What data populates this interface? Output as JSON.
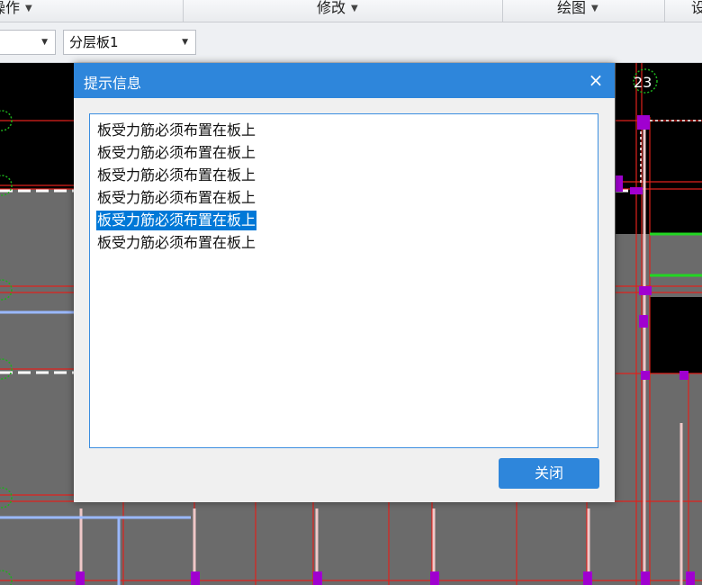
{
  "toolbar": {
    "groups": [
      {
        "label": "操作",
        "label_visible": "操作"
      },
      {
        "label": "修改"
      },
      {
        "label": "绘图"
      },
      {
        "label": "设"
      }
    ],
    "selectors": [
      {
        "value": ""
      },
      {
        "value": "分层板1"
      }
    ]
  },
  "canvas": {
    "axis_labels": [
      "23"
    ],
    "colors": {
      "background": "#6b6b6b",
      "grid_line": "#e0221c",
      "column": "#a000d0",
      "beam_green": "#22d722",
      "beam_blue": "#9ab8ff",
      "axis_circle": "#1cb01c"
    }
  },
  "dialog": {
    "title": "提示信息",
    "close_icon": "×",
    "messages": [
      "板受力筋必须布置在板上",
      "板受力筋必须布置在板上",
      "板受力筋必须布置在板上",
      "板受力筋必须布置在板上",
      "板受力筋必须布置在板上",
      "板受力筋必须布置在板上"
    ],
    "selected_index": 4,
    "close_button": "关闭"
  }
}
